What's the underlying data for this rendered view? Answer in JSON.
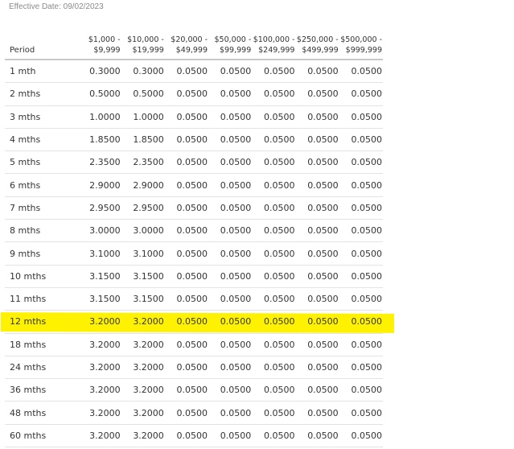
{
  "effective_date": "Effective Date: 09/02/2023",
  "table": {
    "period_header": "Period",
    "tier_headers": [
      {
        "line1": "$1,000 -",
        "line2": "$9,999"
      },
      {
        "line1": "$10,000 -",
        "line2": "$19,999"
      },
      {
        "line1": "$20,000 -",
        "line2": "$49,999"
      },
      {
        "line1": "$50,000 -",
        "line2": "$99,999"
      },
      {
        "line1": "$100,000 -",
        "line2": "$249,999"
      },
      {
        "line1": "$250,000 -",
        "line2": "$499,999"
      },
      {
        "line1": "$500,000 -",
        "line2": "$999,999"
      }
    ],
    "rows": [
      {
        "period": "1 mth",
        "rates": [
          "0.3000",
          "0.3000",
          "0.0500",
          "0.0500",
          "0.0500",
          "0.0500",
          "0.0500"
        ]
      },
      {
        "period": "2 mths",
        "rates": [
          "0.5000",
          "0.5000",
          "0.0500",
          "0.0500",
          "0.0500",
          "0.0500",
          "0.0500"
        ]
      },
      {
        "period": "3 mths",
        "rates": [
          "1.0000",
          "1.0000",
          "0.0500",
          "0.0500",
          "0.0500",
          "0.0500",
          "0.0500"
        ]
      },
      {
        "period": "4 mths",
        "rates": [
          "1.8500",
          "1.8500",
          "0.0500",
          "0.0500",
          "0.0500",
          "0.0500",
          "0.0500"
        ]
      },
      {
        "period": "5 mths",
        "rates": [
          "2.3500",
          "2.3500",
          "0.0500",
          "0.0500",
          "0.0500",
          "0.0500",
          "0.0500"
        ]
      },
      {
        "period": "6 mths",
        "rates": [
          "2.9000",
          "2.9000",
          "0.0500",
          "0.0500",
          "0.0500",
          "0.0500",
          "0.0500"
        ]
      },
      {
        "period": "7 mths",
        "rates": [
          "2.9500",
          "2.9500",
          "0.0500",
          "0.0500",
          "0.0500",
          "0.0500",
          "0.0500"
        ]
      },
      {
        "period": "8 mths",
        "rates": [
          "3.0000",
          "3.0000",
          "0.0500",
          "0.0500",
          "0.0500",
          "0.0500",
          "0.0500"
        ]
      },
      {
        "period": "9 mths",
        "rates": [
          "3.1000",
          "3.1000",
          "0.0500",
          "0.0500",
          "0.0500",
          "0.0500",
          "0.0500"
        ]
      },
      {
        "period": "10 mths",
        "rates": [
          "3.1500",
          "3.1500",
          "0.0500",
          "0.0500",
          "0.0500",
          "0.0500",
          "0.0500"
        ]
      },
      {
        "period": "11 mths",
        "rates": [
          "3.1500",
          "3.1500",
          "0.0500",
          "0.0500",
          "0.0500",
          "0.0500",
          "0.0500"
        ]
      },
      {
        "period": "12 mths",
        "rates": [
          "3.2000",
          "3.2000",
          "0.0500",
          "0.0500",
          "0.0500",
          "0.0500",
          "0.0500"
        ],
        "highlighted": true
      },
      {
        "period": "18 mths",
        "rates": [
          "3.2000",
          "3.2000",
          "0.0500",
          "0.0500",
          "0.0500",
          "0.0500",
          "0.0500"
        ]
      },
      {
        "period": "24 mths",
        "rates": [
          "3.2000",
          "3.2000",
          "0.0500",
          "0.0500",
          "0.0500",
          "0.0500",
          "0.0500"
        ]
      },
      {
        "period": "36 mths",
        "rates": [
          "3.2000",
          "3.2000",
          "0.0500",
          "0.0500",
          "0.0500",
          "0.0500",
          "0.0500"
        ]
      },
      {
        "period": "48 mths",
        "rates": [
          "3.2000",
          "3.2000",
          "0.0500",
          "0.0500",
          "0.0500",
          "0.0500",
          "0.0500"
        ]
      },
      {
        "period": "60 mths",
        "rates": [
          "3.2000",
          "3.2000",
          "0.0500",
          "0.0500",
          "0.0500",
          "0.0500",
          "0.0500"
        ]
      }
    ]
  },
  "colors": {
    "highlight": "#fff200",
    "text": "#333333",
    "muted_text": "#8a8a8a",
    "row_divider": "#e3e3e3"
  }
}
